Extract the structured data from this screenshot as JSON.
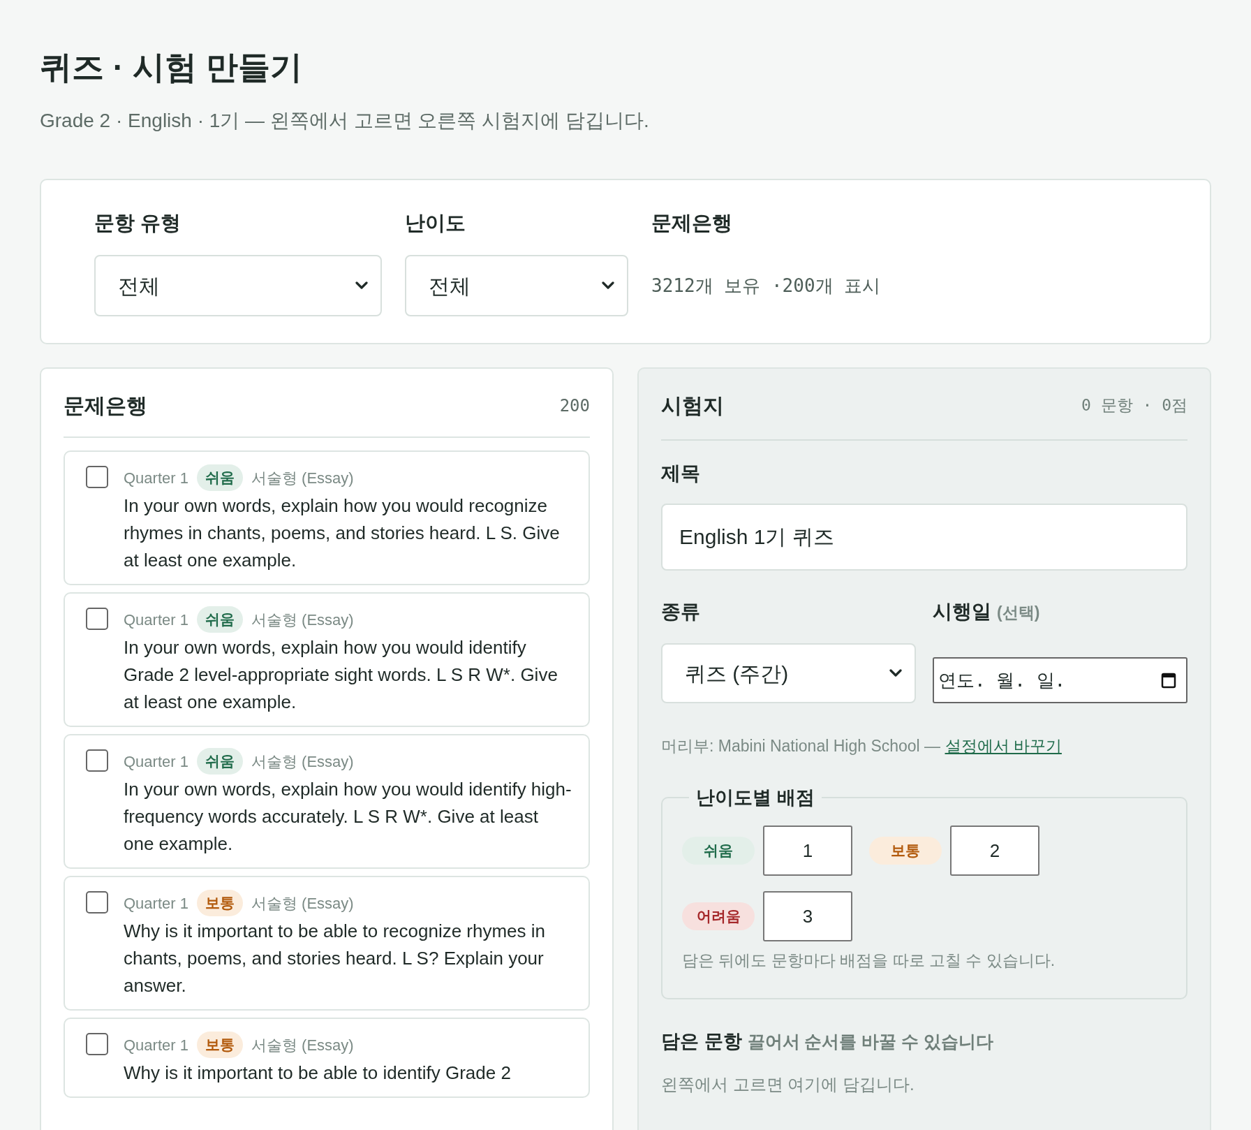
{
  "page": {
    "title": "퀴즈 · 시험 만들기",
    "subtitle": "Grade 2 · English · 1기 — 왼쪽에서 고르면 오른쪽 시험지에 담깁니다."
  },
  "filters": {
    "type": {
      "label": "문항 유형",
      "value": "전체"
    },
    "difficulty": {
      "label": "난이도",
      "value": "전체"
    },
    "bank": {
      "label": "문제은행",
      "summary": "3212개 보유 ·200개 표시"
    }
  },
  "bank_panel": {
    "title": "문제은행",
    "count": "200",
    "questions": [
      {
        "quarter": "Quarter 1",
        "difficulty": {
          "label": "쉬움",
          "kind": "easy"
        },
        "format": "서술형 (Essay)",
        "text": "In your own words, explain how you would recognize rhymes in chants, poems, and stories heard. L S. Give at least one example.",
        "checked": false
      },
      {
        "quarter": "Quarter 1",
        "difficulty": {
          "label": "쉬움",
          "kind": "easy"
        },
        "format": "서술형 (Essay)",
        "text": "In your own words, explain how you would identify Grade 2 level-appropriate sight words. L S R W*. Give at least one example.",
        "checked": false
      },
      {
        "quarter": "Quarter 1",
        "difficulty": {
          "label": "쉬움",
          "kind": "easy"
        },
        "format": "서술형 (Essay)",
        "text": "In your own words, explain how you would identify high-frequency words accurately. L S R W*. Give at least one example.",
        "checked": false
      },
      {
        "quarter": "Quarter 1",
        "difficulty": {
          "label": "보통",
          "kind": "medium"
        },
        "format": "서술형 (Essay)",
        "text": "Why is it important to be able to recognize rhymes in chants, poems, and stories heard. L S? Explain your answer.",
        "checked": false
      },
      {
        "quarter": "Quarter 1",
        "difficulty": {
          "label": "보통",
          "kind": "medium"
        },
        "format": "서술형 (Essay)",
        "text": "Why is it important to be able to identify Grade 2",
        "checked": false
      }
    ]
  },
  "exam_panel": {
    "title": "시험지",
    "summary": "0 문항 · 0점",
    "title_field": {
      "label": "제목",
      "value": "English 1기 퀴즈"
    },
    "kind_field": {
      "label": "종류",
      "value": "퀴즈 (주간)"
    },
    "date_field": {
      "label": "시행일",
      "hint": "(선택)",
      "placeholder": "연도. 월. 일."
    },
    "header_note": {
      "text": "머리부: Mabini National High School — ",
      "link": "설정에서 바꾸기"
    },
    "points": {
      "legend": "난이도별 배점",
      "items": [
        {
          "label": "쉬움",
          "kind": "easy",
          "value": "1"
        },
        {
          "label": "보통",
          "kind": "medium",
          "value": "2"
        },
        {
          "label": "어려움",
          "kind": "hard",
          "value": "3"
        }
      ],
      "note": "담은 뒤에도 문항마다 배점을 따로 고칠 수 있습니다."
    },
    "selected": {
      "title": "담은 문항",
      "hint": "끌어서 순서를 바꿀 수 있습니다",
      "empty": "왼쪽에서 고르면 여기에 담깁니다."
    }
  }
}
